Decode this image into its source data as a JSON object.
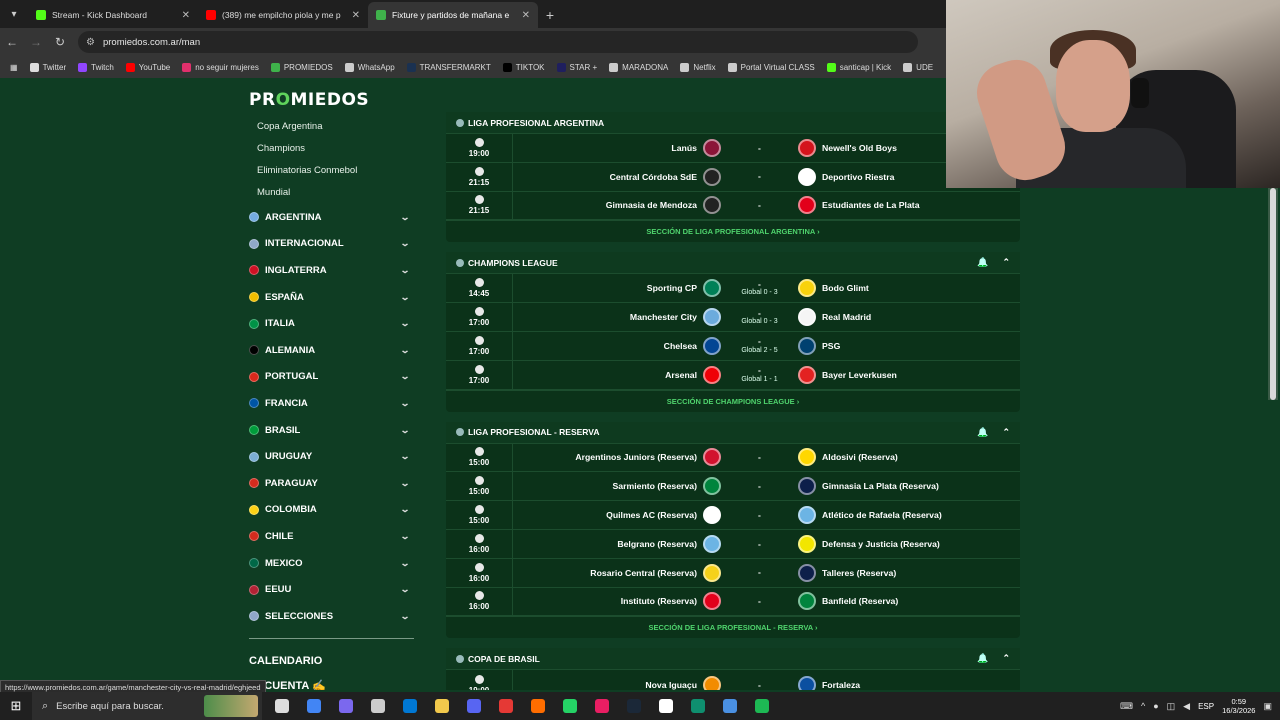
{
  "browser": {
    "tabs": [
      {
        "title": "Stream - Kick Dashboard",
        "active": false,
        "fav_color": "#53fc18"
      },
      {
        "title": "(389) me empilcho piola y me p",
        "active": false,
        "fav_color": "#ff0000"
      },
      {
        "title": "Fixture y partidos de mañana e",
        "active": true,
        "fav_color": "#3fb24b"
      }
    ],
    "url": "promiedos.com.ar/man",
    "bookmarks": [
      {
        "label": "Twitter",
        "color": "#dddddd"
      },
      {
        "label": "Twitch",
        "color": "#9146ff"
      },
      {
        "label": "YouTube",
        "color": "#ff0000"
      },
      {
        "label": "no seguir mujeres",
        "color": "#e1306c"
      },
      {
        "label": "PROMIEDOS",
        "color": "#3fb24b"
      },
      {
        "label": "WhatsApp",
        "color": "#cccccc"
      },
      {
        "label": "TRANSFERMARKT",
        "color": "#1a3151"
      },
      {
        "label": "TIKTOK",
        "color": "#000000"
      },
      {
        "label": "STAR +",
        "color": "#1f1f5e"
      },
      {
        "label": "MARADONA",
        "color": "#cccccc"
      },
      {
        "label": "Netflix",
        "color": "#cccccc"
      },
      {
        "label": "Portal Virtual CLASS",
        "color": "#cccccc"
      },
      {
        "label": "santicap | Kick",
        "color": "#53fc18"
      },
      {
        "label": "UDE",
        "color": "#cccccc"
      }
    ],
    "status_url": "https://www.promiedos.com.ar/game/manchester-city-vs-real-madrid/eghjeed"
  },
  "site": {
    "logo_pre": "PR",
    "logo_o": "O",
    "logo_post": "MIEDOS"
  },
  "sidebar": {
    "links": [
      "Copa Argentina",
      "Champions",
      "Eliminatorias Conmebol",
      "Mundial"
    ],
    "countries": [
      {
        "name": "ARGENTINA",
        "flag": "#74acdf"
      },
      {
        "name": "INTERNACIONAL",
        "flag": "#8fa8c8"
      },
      {
        "name": "INGLATERRA",
        "flag": "#ce1124"
      },
      {
        "name": "ESPAÑA",
        "flag": "#f1bf00"
      },
      {
        "name": "ITALIA",
        "flag": "#009246"
      },
      {
        "name": "ALEMANIA",
        "flag": "#000000"
      },
      {
        "name": "PORTUGAL",
        "flag": "#da291c"
      },
      {
        "name": "FRANCIA",
        "flag": "#0055a4"
      },
      {
        "name": "BRASIL",
        "flag": "#009c3b"
      },
      {
        "name": "URUGUAY",
        "flag": "#7bafd4"
      },
      {
        "name": "PARAGUAY",
        "flag": "#d52b1e"
      },
      {
        "name": "COLOMBIA",
        "flag": "#fcd116"
      },
      {
        "name": "CHILE",
        "flag": "#d52b1e"
      },
      {
        "name": "MEXICO",
        "flag": "#006847"
      },
      {
        "name": "EEUU",
        "flag": "#b22234"
      },
      {
        "name": "SELECCIONES",
        "flag": "#8fa8c8"
      }
    ],
    "calendar_label": "CALENDARIO",
    "account_label": "MI CUENTA"
  },
  "leagues": [
    {
      "title": "LIGA PROFESIONAL ARGENTINA",
      "show_head_actions": false,
      "matches": [
        {
          "time": "19:00",
          "home": "Lanús",
          "away": "Newell's Old Boys",
          "score": "-",
          "agg": "",
          "home_color": "#8b1538",
          "away_color": "#d4141c"
        },
        {
          "time": "21:15",
          "home": "Central Córdoba SdE",
          "away": "Deportivo Riestra",
          "score": "-",
          "agg": "",
          "home_color": "#222222",
          "away_color": "#ffffff"
        },
        {
          "time": "21:15",
          "home": "Gimnasia de Mendoza",
          "away": "Estudiantes de La Plata",
          "score": "-",
          "agg": "",
          "home_color": "#222222",
          "away_color": "#e2001a"
        }
      ],
      "section_link": "SECCIÓN DE LIGA PROFESIONAL ARGENTINA ›"
    },
    {
      "title": "CHAMPIONS LEAGUE",
      "show_head_actions": true,
      "matches": [
        {
          "time": "14:45",
          "home": "Sporting CP",
          "away": "Bodo Glimt",
          "score": "-",
          "agg": "Global 0 - 3",
          "home_color": "#008057",
          "away_color": "#f8d20c"
        },
        {
          "time": "17:00",
          "home": "Manchester City",
          "away": "Real Madrid",
          "score": "-",
          "agg": "Global 0 - 3",
          "home_color": "#6cabdd",
          "away_color": "#f5f5f5"
        },
        {
          "time": "17:00",
          "home": "Chelsea",
          "away": "PSG",
          "score": "-",
          "agg": "Global 2 - 5",
          "home_color": "#034694",
          "away_color": "#004170"
        },
        {
          "time": "17:00",
          "home": "Arsenal",
          "away": "Bayer Leverkusen",
          "score": "-",
          "agg": "Global 1 - 1",
          "home_color": "#ef0107",
          "away_color": "#e32221"
        }
      ],
      "section_link": "SECCIÓN DE CHAMPIONS LEAGUE ›"
    },
    {
      "title": "LIGA PROFESIONAL - RESERVA",
      "show_head_actions": true,
      "matches": [
        {
          "time": "15:00",
          "home": "Argentinos Juniors (Reserva)",
          "away": "Aldosivi (Reserva)",
          "score": "-",
          "agg": "",
          "home_color": "#d2122e",
          "away_color": "#ffd700"
        },
        {
          "time": "15:00",
          "home": "Sarmiento (Reserva)",
          "away": "Gimnasia La Plata (Reserva)",
          "score": "-",
          "agg": "",
          "home_color": "#00843d",
          "away_color": "#0d1f4a"
        },
        {
          "time": "15:00",
          "home": "Quilmes AC (Reserva)",
          "away": "Atlético de Rafaela (Reserva)",
          "score": "-",
          "agg": "",
          "home_color": "#ffffff",
          "away_color": "#6cb4e4"
        },
        {
          "time": "16:00",
          "home": "Belgrano (Reserva)",
          "away": "Defensa y Justicia (Reserva)",
          "score": "-",
          "agg": "",
          "home_color": "#6cb4e4",
          "away_color": "#f2e600"
        },
        {
          "time": "16:00",
          "home": "Rosario Central (Reserva)",
          "away": "Talleres (Reserva)",
          "score": "-",
          "agg": "",
          "home_color": "#f5d11a",
          "away_color": "#0d1f4a"
        },
        {
          "time": "16:00",
          "home": "Instituto (Reserva)",
          "away": "Banfield (Reserva)",
          "score": "-",
          "agg": "",
          "home_color": "#e2001a",
          "away_color": "#00843d"
        }
      ],
      "section_link": "SECCIÓN DE LIGA PROFESIONAL - RESERVA ›"
    },
    {
      "title": "COPA DE BRASIL",
      "show_head_actions": true,
      "matches": [
        {
          "time": "19:00",
          "home": "Nova Iguaçu",
          "away": "Fortaleza",
          "score": "-",
          "agg": "",
          "home_color": "#f28c00",
          "away_color": "#0b4fa0"
        }
      ],
      "section_link": ""
    }
  ],
  "taskbar": {
    "search_placeholder": "Escribe aquí para buscar.",
    "lang": "ESP",
    "time": "0:59",
    "date": "16/3/2026",
    "apps": [
      "#dddddd",
      "#4285f4",
      "#7b68ee",
      "#cccccc",
      "#0078d4",
      "#f2c94c",
      "#5865f2",
      "#e53935",
      "#ff6d00",
      "#25d366",
      "#e91e63",
      "#1b2838",
      "#ffffff",
      "#0f8f6f",
      "#4a90e2",
      "#1db954"
    ]
  }
}
